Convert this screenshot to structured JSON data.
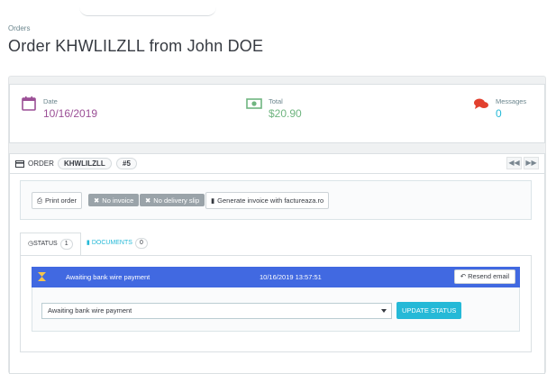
{
  "breadcrumb": "Orders",
  "page_title": "Order KHWLILZLL from John DOE",
  "kpis": {
    "date": {
      "label": "Date",
      "value": "10/16/2019",
      "color": "#9b4f96"
    },
    "total": {
      "label": "Total",
      "value": "$20.90",
      "color": "#70b580"
    },
    "messages": {
      "label": "Messages",
      "value": "0",
      "color": "#25b9d7"
    }
  },
  "order_header": {
    "label": "ORDER",
    "reference": "KHWLILZLL",
    "number": "#5",
    "prev_icon": "rewind-icon",
    "next_icon": "fast-forward-icon"
  },
  "actions": {
    "print": "Print order",
    "no_invoice": "No invoice",
    "no_delivery": "No delivery slip",
    "generate": "Generate invoice with factureaza.ro"
  },
  "tabs": {
    "status": {
      "label": "STATUS",
      "count": "1"
    },
    "documents": {
      "label": "DOCUMENTS",
      "count": "0"
    }
  },
  "status_history": [
    {
      "status": "Awaiting bank wire payment",
      "date": "10/16/2019 13:57:51",
      "action": "Resend email"
    }
  ],
  "status_select": {
    "value": "Awaiting bank wire payment"
  },
  "update_button": "UPDATE STATUS",
  "colors": {
    "accent": "#25b9d7",
    "status_row": "#4169e1"
  }
}
